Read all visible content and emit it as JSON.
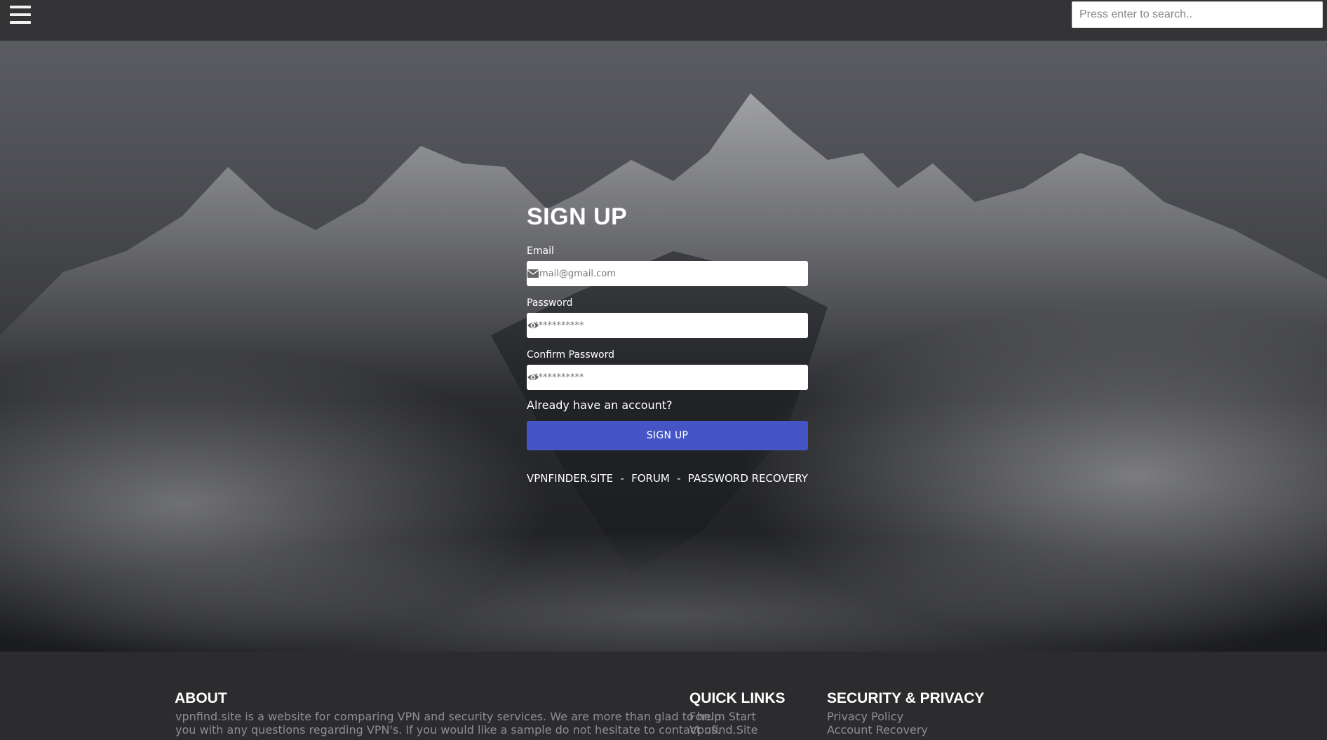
{
  "navbar": {
    "search_placeholder": "Press enter to search.."
  },
  "signup": {
    "title": "SIGN UP",
    "email_label": "Email",
    "email_placeholder": "email@gmail.com",
    "password_label": "Password",
    "password_placeholder": "***********",
    "confirm_label": "Confirm Password",
    "confirm_placeholder": "***********",
    "login_link": "Already have an account?",
    "submit_label": "SIGN UP",
    "links": [
      "VPNFINDER.SITE",
      "FORUM",
      "PASSWORD RECOVERY"
    ],
    "separator": "-"
  },
  "footer": {
    "about_title": "ABOUT",
    "about_text_1": "vpnfind.site is a website for comparing VPN and security services. We are more than glad to help",
    "about_text_2": "you with any questions regarding VPN's. If you would like a sample do not hesitate to contact us.",
    "quick_title": "QUICK LINKS",
    "quick_links": [
      "Forum Start",
      "Vpnfind.Site"
    ],
    "security_title": "SECURITY & PRIVACY",
    "security_links": [
      "Privacy Policy",
      "Account Recovery"
    ]
  },
  "colors": {
    "navbar_bg": "#343436",
    "accent_button": "#4555c6",
    "footer_bg": "#2c2c2e"
  }
}
